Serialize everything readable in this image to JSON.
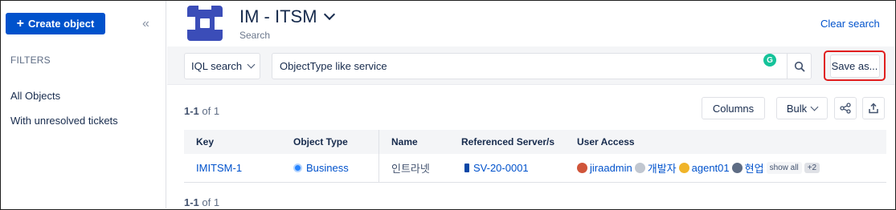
{
  "sidebar": {
    "create_label": "Create object",
    "filters_label": "FILTERS",
    "items": [
      {
        "label": "All Objects"
      },
      {
        "label": "With unresolved tickets"
      }
    ]
  },
  "header": {
    "title": "IM - ITSM",
    "subtitle": "Search",
    "clear_search": "Clear search"
  },
  "search": {
    "mode": "IQL search",
    "query": "ObjectType like service",
    "save_as": "Save as..."
  },
  "results": {
    "count_range": "1-1",
    "count_of": "of 1",
    "columns_label": "Columns",
    "bulk_label": "Bulk"
  },
  "table": {
    "headers": [
      "Key",
      "Object Type",
      "Name",
      "Referenced Server/s",
      "User Access"
    ],
    "rows": [
      {
        "key": "IMITSM-1",
        "object_type": "Business",
        "name": "인트라넷",
        "server": "SV-20-0001",
        "users": [
          "jiraadmin",
          "개발자",
          "agent01",
          "현업"
        ],
        "show_all": "show all",
        "more": "+2"
      }
    ]
  },
  "colors": {
    "primary": "#0052cc",
    "highlight": "#e01e1e",
    "logo": "#3b4db8"
  }
}
